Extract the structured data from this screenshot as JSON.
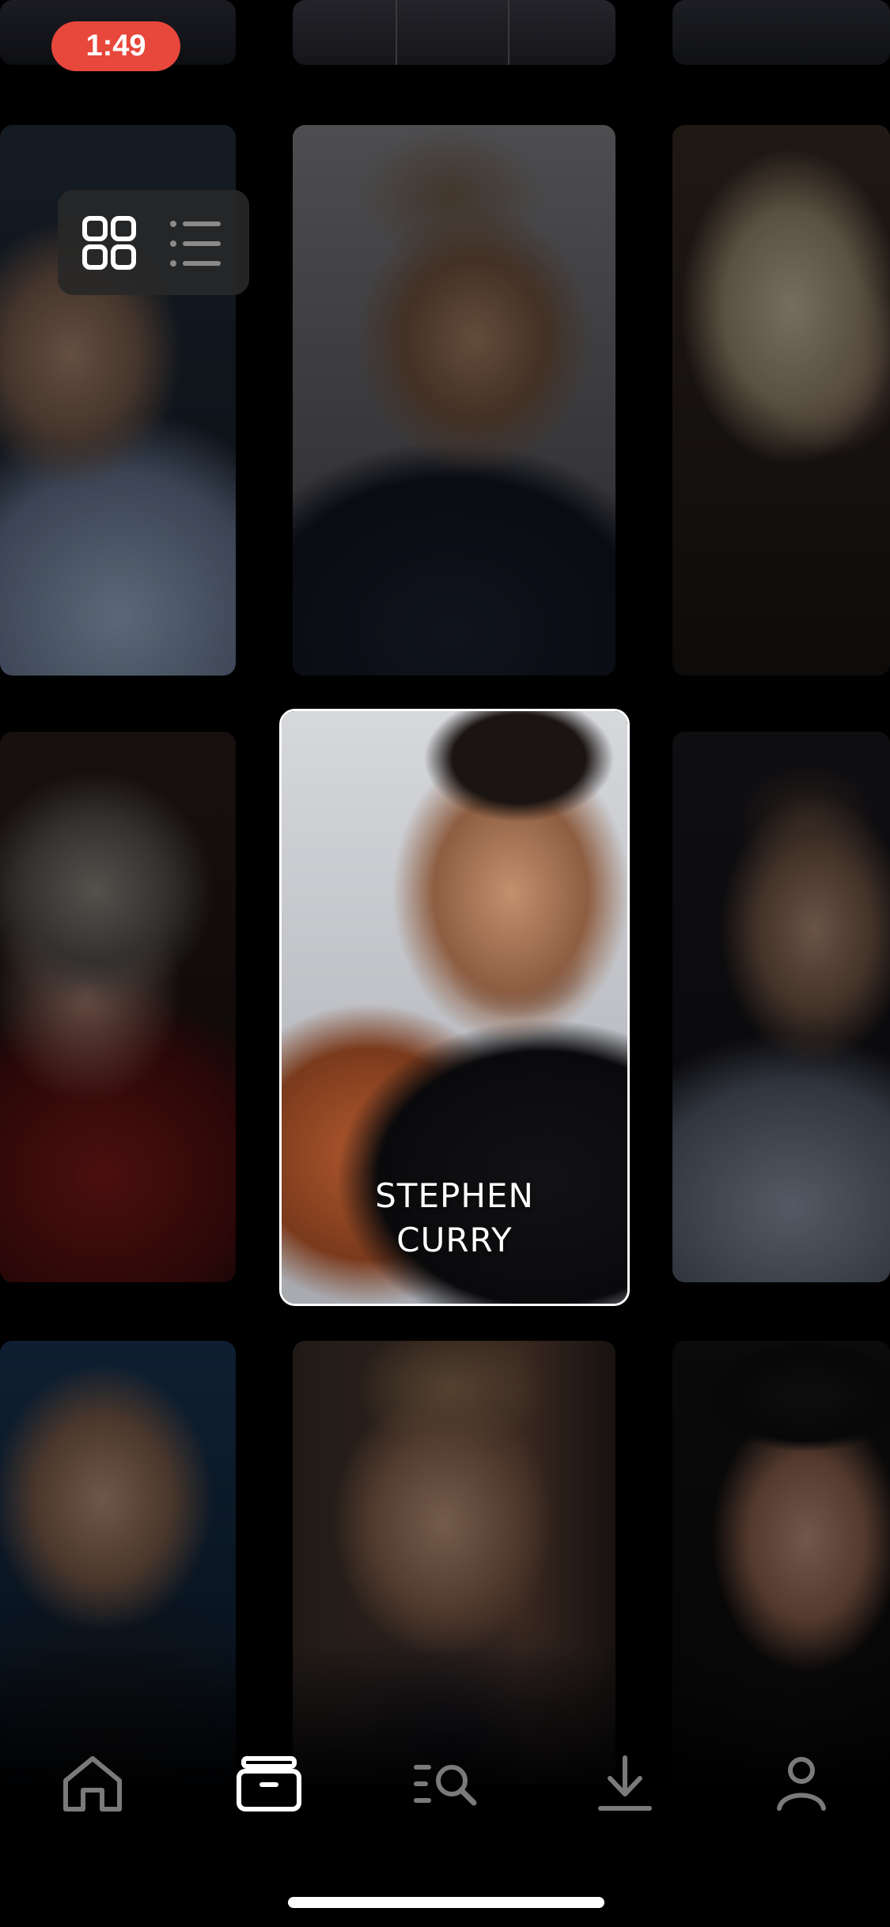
{
  "status_bar": {
    "time": "1:49"
  },
  "view_toggle": {
    "grid_icon": "grid-icon",
    "list_icon": "list-icon",
    "active": "grid"
  },
  "cards": [
    {
      "id": "card-top-partial-1"
    },
    {
      "id": "card-chris"
    },
    {
      "id": "card-gordon"
    },
    {
      "id": "card-annie"
    },
    {
      "id": "card-margaret"
    },
    {
      "id": "card-stephen",
      "name": "STEPHEN CURRY",
      "name_line1": "STEPHEN",
      "name_line2": "CURRY",
      "selected": true
    },
    {
      "id": "card-malcolm"
    },
    {
      "id": "card-person-7"
    },
    {
      "id": "card-alice"
    },
    {
      "id": "card-ron"
    }
  ],
  "tab_bar": {
    "tabs": [
      {
        "icon": "home-icon",
        "active": false
      },
      {
        "icon": "library-icon",
        "active": true
      },
      {
        "icon": "search-icon",
        "active": false
      },
      {
        "icon": "download-icon",
        "active": false
      },
      {
        "icon": "profile-icon",
        "active": false
      }
    ]
  },
  "colors": {
    "accent": "#e8473c",
    "background": "#000000",
    "inactive_icon": "#7a7a7a",
    "active_icon": "#ffffff"
  }
}
